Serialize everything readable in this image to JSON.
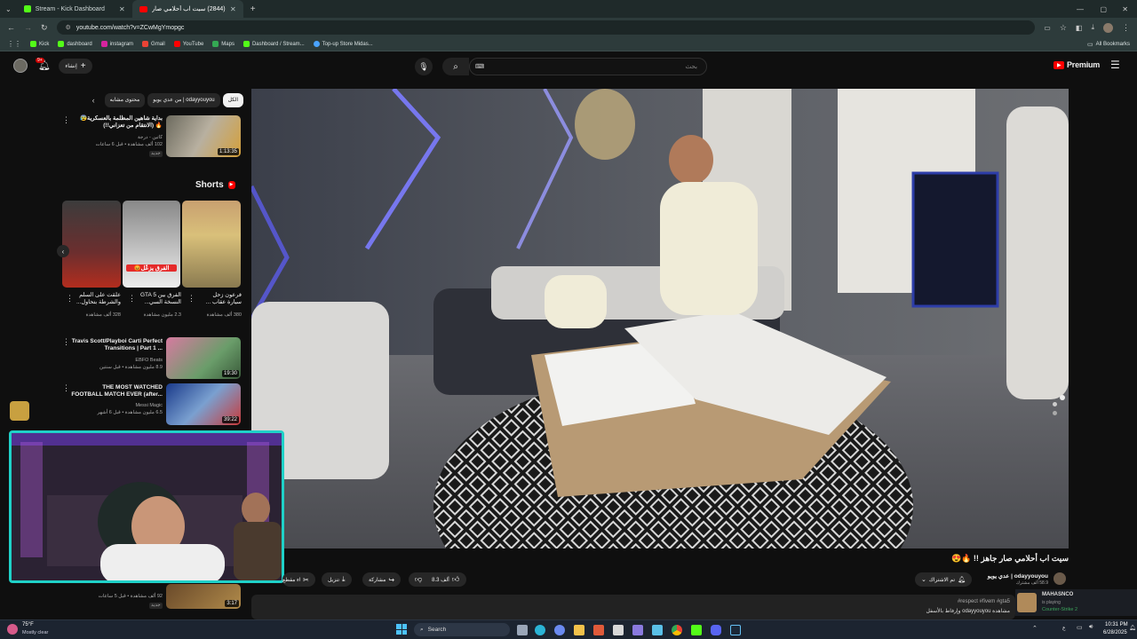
{
  "browser": {
    "tabs": [
      {
        "label": "Stream - Kick Dashboard",
        "active": false
      },
      {
        "label": "(2844) سيت اب أحلامي صار",
        "active": true
      }
    ],
    "new_tab": "+",
    "url": "youtube.com/watch?v=ZCwMgYmopgc",
    "bookmarks": [
      "Kick",
      "dashboard",
      "instagram",
      "Gmail",
      "YouTube",
      "Maps",
      "Dashboard / Stream...",
      "Top-up Store Midas..."
    ],
    "all_bookmarks": "All Bookmarks"
  },
  "youtube": {
    "create_label": "إنشاء",
    "notification_count": "9+",
    "search_placeholder": "بحث",
    "brand": "Premium",
    "chips": [
      "الكل",
      "من عدي يويو | odayyouyou",
      "محتوى مشابه"
    ],
    "related_top": {
      "title": "بداية شاهين المظلمة بالعسكرية😰🔥 (الانتقام من تعزاني!!)",
      "channel": "كاتين - درجة",
      "meta": "102 ألف مشاهدة • قبل 6 ساعات",
      "badge": "جديد",
      "duration": "1:13:35"
    },
    "shorts_label": "Shorts",
    "shorts": [
      {
        "title": "فرعون زحل سيارة عقاب ...",
        "views": "380 ألف مشاهدة"
      },
      {
        "title": "الفرق بين GTA 5 النسخة السي...",
        "views": "2.3 مليون مشاهدة",
        "overlay": "الفرق يزعّل😡"
      },
      {
        "title": "علقت على السلم والشرطة بتحاول...",
        "views": "328 ألف مشاهدة"
      }
    ],
    "related": [
      {
        "title": "Travis Scott/Playboi Carti Perfect Transitions | Part 1 ...",
        "channel": "EBFO Beats",
        "meta": "8.9 مليون مشاهدة • قبل سنتين",
        "duration": "19:30"
      },
      {
        "title": "THE MOST WATCHED FOOTBALL MATCH EVER (after...",
        "channel": "Messi Magic",
        "meta": "6.5 مليون مشاهدة • قبل 6 أشهر",
        "duration": "39:22"
      },
      {
        "title": "",
        "channel": "",
        "meta": "92 ألف مشاهدة • قبل 5 ساعات",
        "duration": "3:17",
        "badge": "جديد"
      }
    ],
    "video": {
      "title": "سيت اب أحلامي صار جاهز !! 🔥😍",
      "channel": "عدي يويو | odayyouyou",
      "subscribers": "58.9 ألف مشترك",
      "subscribe": "تم الاشتراك",
      "likes": "8.3 ألف",
      "share": "مشاركة",
      "download": "تنزيل",
      "clip": "إنشاء مقطع",
      "hashtags": "#respect #fivem #gta5",
      "desc_line": "مشاهدة odayyouyou وإرفاط بالأسفل"
    }
  },
  "overlay": {
    "playing_name": "MAHASNCO",
    "playing_status": "is playing",
    "playing_game": "Counter-Strike 2"
  },
  "taskbar": {
    "weather_temp": "75°F",
    "weather_desc": "Mostly clear",
    "search_label": "Search",
    "time": "10:31 PM",
    "date": "6/28/2025"
  },
  "colors": {
    "accent_red": "#ff0000",
    "cam_border": "#1fd1c8",
    "kick_green": "#53fc18"
  }
}
